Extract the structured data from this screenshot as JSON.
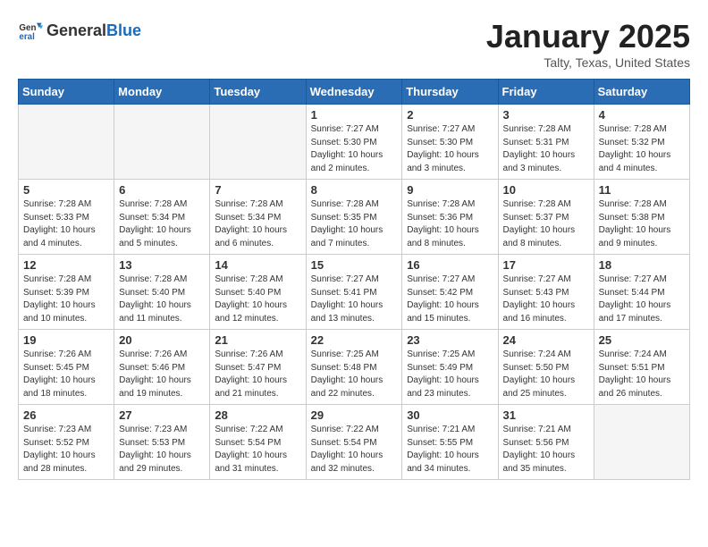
{
  "header": {
    "logo": {
      "general": "General",
      "blue": "Blue"
    },
    "title": "January 2025",
    "subtitle": "Talty, Texas, United States"
  },
  "weekdays": [
    "Sunday",
    "Monday",
    "Tuesday",
    "Wednesday",
    "Thursday",
    "Friday",
    "Saturday"
  ],
  "weeks": [
    [
      {
        "day": null,
        "info": null
      },
      {
        "day": null,
        "info": null
      },
      {
        "day": null,
        "info": null
      },
      {
        "day": "1",
        "info": "Sunrise: 7:27 AM\nSunset: 5:30 PM\nDaylight: 10 hours\nand 2 minutes."
      },
      {
        "day": "2",
        "info": "Sunrise: 7:27 AM\nSunset: 5:30 PM\nDaylight: 10 hours\nand 3 minutes."
      },
      {
        "day": "3",
        "info": "Sunrise: 7:28 AM\nSunset: 5:31 PM\nDaylight: 10 hours\nand 3 minutes."
      },
      {
        "day": "4",
        "info": "Sunrise: 7:28 AM\nSunset: 5:32 PM\nDaylight: 10 hours\nand 4 minutes."
      }
    ],
    [
      {
        "day": "5",
        "info": "Sunrise: 7:28 AM\nSunset: 5:33 PM\nDaylight: 10 hours\nand 4 minutes."
      },
      {
        "day": "6",
        "info": "Sunrise: 7:28 AM\nSunset: 5:34 PM\nDaylight: 10 hours\nand 5 minutes."
      },
      {
        "day": "7",
        "info": "Sunrise: 7:28 AM\nSunset: 5:34 PM\nDaylight: 10 hours\nand 6 minutes."
      },
      {
        "day": "8",
        "info": "Sunrise: 7:28 AM\nSunset: 5:35 PM\nDaylight: 10 hours\nand 7 minutes."
      },
      {
        "day": "9",
        "info": "Sunrise: 7:28 AM\nSunset: 5:36 PM\nDaylight: 10 hours\nand 8 minutes."
      },
      {
        "day": "10",
        "info": "Sunrise: 7:28 AM\nSunset: 5:37 PM\nDaylight: 10 hours\nand 8 minutes."
      },
      {
        "day": "11",
        "info": "Sunrise: 7:28 AM\nSunset: 5:38 PM\nDaylight: 10 hours\nand 9 minutes."
      }
    ],
    [
      {
        "day": "12",
        "info": "Sunrise: 7:28 AM\nSunset: 5:39 PM\nDaylight: 10 hours\nand 10 minutes."
      },
      {
        "day": "13",
        "info": "Sunrise: 7:28 AM\nSunset: 5:40 PM\nDaylight: 10 hours\nand 11 minutes."
      },
      {
        "day": "14",
        "info": "Sunrise: 7:28 AM\nSunset: 5:40 PM\nDaylight: 10 hours\nand 12 minutes."
      },
      {
        "day": "15",
        "info": "Sunrise: 7:27 AM\nSunset: 5:41 PM\nDaylight: 10 hours\nand 13 minutes."
      },
      {
        "day": "16",
        "info": "Sunrise: 7:27 AM\nSunset: 5:42 PM\nDaylight: 10 hours\nand 15 minutes."
      },
      {
        "day": "17",
        "info": "Sunrise: 7:27 AM\nSunset: 5:43 PM\nDaylight: 10 hours\nand 16 minutes."
      },
      {
        "day": "18",
        "info": "Sunrise: 7:27 AM\nSunset: 5:44 PM\nDaylight: 10 hours\nand 17 minutes."
      }
    ],
    [
      {
        "day": "19",
        "info": "Sunrise: 7:26 AM\nSunset: 5:45 PM\nDaylight: 10 hours\nand 18 minutes."
      },
      {
        "day": "20",
        "info": "Sunrise: 7:26 AM\nSunset: 5:46 PM\nDaylight: 10 hours\nand 19 minutes."
      },
      {
        "day": "21",
        "info": "Sunrise: 7:26 AM\nSunset: 5:47 PM\nDaylight: 10 hours\nand 21 minutes."
      },
      {
        "day": "22",
        "info": "Sunrise: 7:25 AM\nSunset: 5:48 PM\nDaylight: 10 hours\nand 22 minutes."
      },
      {
        "day": "23",
        "info": "Sunrise: 7:25 AM\nSunset: 5:49 PM\nDaylight: 10 hours\nand 23 minutes."
      },
      {
        "day": "24",
        "info": "Sunrise: 7:24 AM\nSunset: 5:50 PM\nDaylight: 10 hours\nand 25 minutes."
      },
      {
        "day": "25",
        "info": "Sunrise: 7:24 AM\nSunset: 5:51 PM\nDaylight: 10 hours\nand 26 minutes."
      }
    ],
    [
      {
        "day": "26",
        "info": "Sunrise: 7:23 AM\nSunset: 5:52 PM\nDaylight: 10 hours\nand 28 minutes."
      },
      {
        "day": "27",
        "info": "Sunrise: 7:23 AM\nSunset: 5:53 PM\nDaylight: 10 hours\nand 29 minutes."
      },
      {
        "day": "28",
        "info": "Sunrise: 7:22 AM\nSunset: 5:54 PM\nDaylight: 10 hours\nand 31 minutes."
      },
      {
        "day": "29",
        "info": "Sunrise: 7:22 AM\nSunset: 5:54 PM\nDaylight: 10 hours\nand 32 minutes."
      },
      {
        "day": "30",
        "info": "Sunrise: 7:21 AM\nSunset: 5:55 PM\nDaylight: 10 hours\nand 34 minutes."
      },
      {
        "day": "31",
        "info": "Sunrise: 7:21 AM\nSunset: 5:56 PM\nDaylight: 10 hours\nand 35 minutes."
      },
      {
        "day": null,
        "info": null
      }
    ]
  ]
}
